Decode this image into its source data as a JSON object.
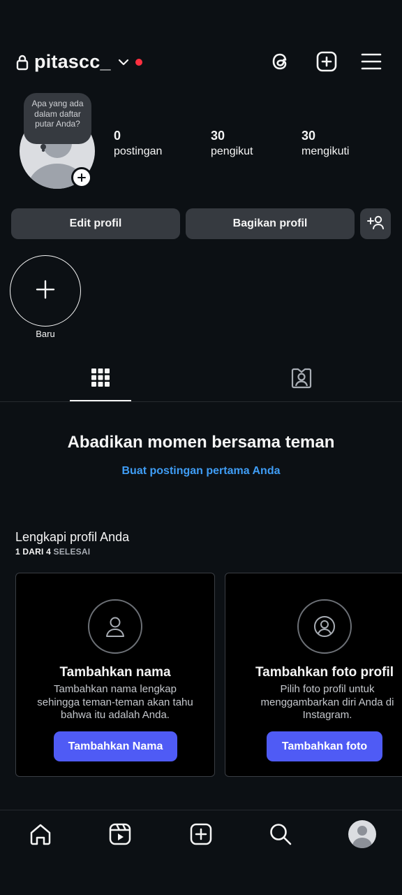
{
  "header": {
    "username": "pitascc_",
    "icons": [
      "lock-icon",
      "chevron-down-icon",
      "threads-icon",
      "create-icon",
      "menu-icon"
    ],
    "notification_dot_color": "#ff3040"
  },
  "profile": {
    "note_text": "Apa yang ada dalam daftar putar Anda?",
    "stats": [
      {
        "count": "0",
        "label": "postingan"
      },
      {
        "count": "30",
        "label": "pengikut"
      },
      {
        "count": "30",
        "label": "mengikuti"
      }
    ],
    "edit_button": "Edit profil",
    "share_button": "Bagikan profil"
  },
  "highlights": {
    "new_label": "Baru"
  },
  "tabs": [
    "grid-icon",
    "tagged-icon"
  ],
  "empty_state": {
    "title": "Abadikan momen bersama teman",
    "link": "Buat postingan pertama Anda",
    "link_color": "#3f9df5"
  },
  "complete_profile": {
    "title": "Lengkapi profil Anda",
    "progress_prefix": "1 DARI 4",
    "progress_suffix": "SELESAI",
    "cards": [
      {
        "icon": "person-icon",
        "title": "Tambahkan nama",
        "description": "Tambahkan nama lengkap sehingga teman-teman akan tahu bahwa itu adalah Anda.",
        "button": "Tambahkan Nama"
      },
      {
        "icon": "profile-photo-icon",
        "title": "Tambahkan foto profil",
        "description": "Pilih foto profil untuk menggambarkan diri Anda di Instagram.",
        "button": "Tambahkan foto"
      }
    ],
    "button_color": "#4f5bf5"
  },
  "bottom_nav": [
    "home-icon",
    "reels-icon",
    "create-icon",
    "search-icon",
    "profile-avatar"
  ]
}
